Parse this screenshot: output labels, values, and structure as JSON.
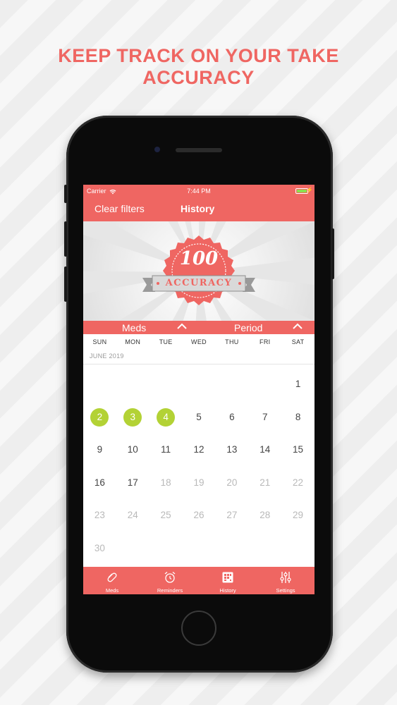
{
  "headline": "KEEP TRACK ON YOUR TAKE ACCURACY",
  "colors": {
    "accent": "#ef6662",
    "taken": "#b3d235",
    "future_day": "#b9b9b9"
  },
  "status_bar": {
    "carrier": "Carrier",
    "time": "7:44 PM"
  },
  "nav": {
    "left_button": "Clear filters",
    "title": "History"
  },
  "accuracy_badge": {
    "value": "100",
    "label": "ACCURACY"
  },
  "filters": {
    "meds": "Meds",
    "period": "Period"
  },
  "calendar": {
    "weekdays": [
      "SUN",
      "MON",
      "TUE",
      "WED",
      "THU",
      "FRI",
      "SAT"
    ],
    "month_label": "JUNE 2019",
    "weeks": [
      [
        null,
        null,
        null,
        null,
        null,
        null,
        {
          "n": "1",
          "state": "past"
        }
      ],
      [
        {
          "n": "2",
          "state": "taken"
        },
        {
          "n": "3",
          "state": "taken"
        },
        {
          "n": "4",
          "state": "taken"
        },
        {
          "n": "5",
          "state": "past"
        },
        {
          "n": "6",
          "state": "past"
        },
        {
          "n": "7",
          "state": "past"
        },
        {
          "n": "8",
          "state": "past"
        }
      ],
      [
        {
          "n": "9",
          "state": "past"
        },
        {
          "n": "10",
          "state": "past"
        },
        {
          "n": "11",
          "state": "past"
        },
        {
          "n": "12",
          "state": "past"
        },
        {
          "n": "13",
          "state": "past"
        },
        {
          "n": "14",
          "state": "past"
        },
        {
          "n": "15",
          "state": "past"
        }
      ],
      [
        {
          "n": "16",
          "state": "past"
        },
        {
          "n": "17",
          "state": "past"
        },
        {
          "n": "18",
          "state": "future"
        },
        {
          "n": "19",
          "state": "future"
        },
        {
          "n": "20",
          "state": "future"
        },
        {
          "n": "21",
          "state": "future"
        },
        {
          "n": "22",
          "state": "future"
        }
      ],
      [
        {
          "n": "23",
          "state": "future"
        },
        {
          "n": "24",
          "state": "future"
        },
        {
          "n": "25",
          "state": "future"
        },
        {
          "n": "26",
          "state": "future"
        },
        {
          "n": "27",
          "state": "future"
        },
        {
          "n": "28",
          "state": "future"
        },
        {
          "n": "29",
          "state": "future"
        }
      ],
      [
        {
          "n": "30",
          "state": "future"
        },
        null,
        null,
        null,
        null,
        null,
        null
      ]
    ]
  },
  "tabs": [
    {
      "label": "Meds",
      "icon": "pill-icon"
    },
    {
      "label": "Reminders",
      "icon": "alarm-clock-icon"
    },
    {
      "label": "History",
      "icon": "history-calendar-icon"
    },
    {
      "label": "Settings",
      "icon": "sliders-icon"
    }
  ]
}
